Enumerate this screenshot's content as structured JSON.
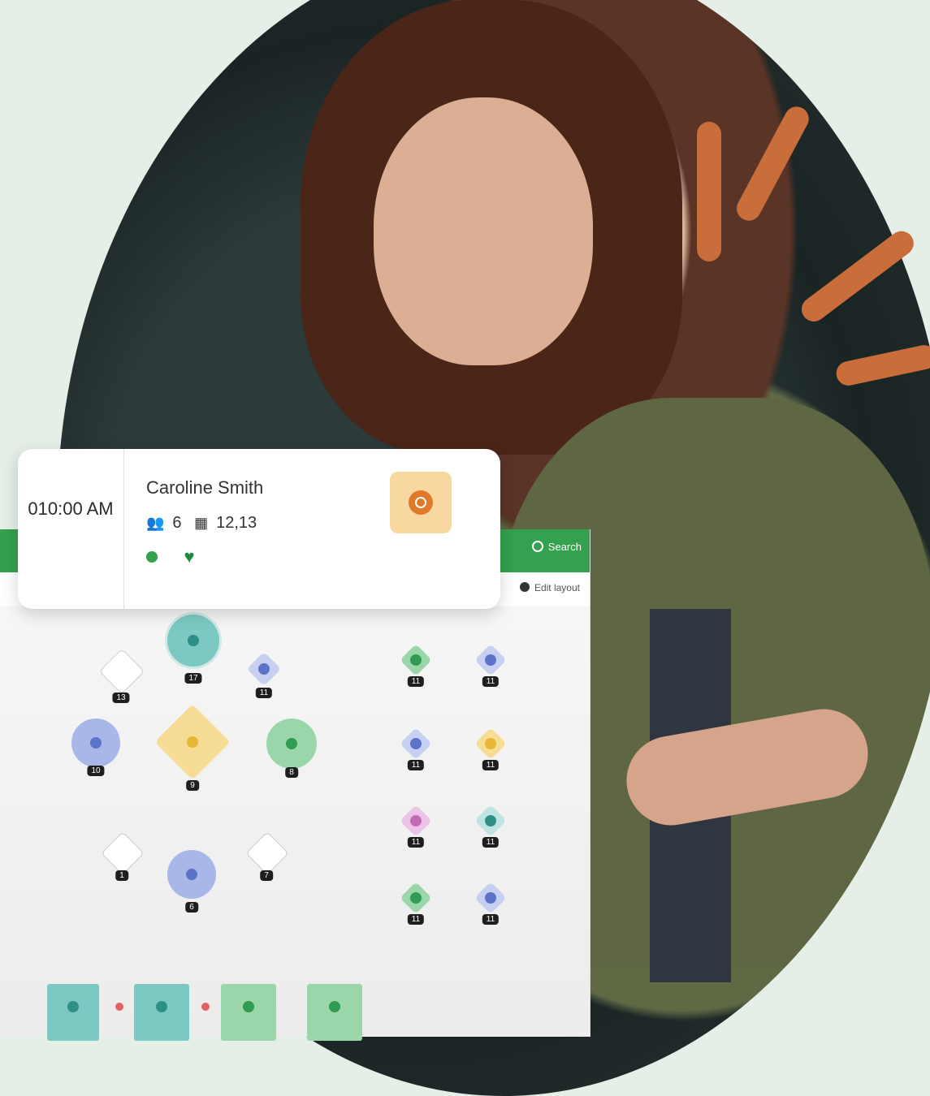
{
  "app": {
    "search_label": "Search",
    "edit_layout_label": "Edit layout"
  },
  "reservation": {
    "time": "010:00 AM",
    "guest_name": "Caroline Smith",
    "party_size": "6",
    "tables": "12,13"
  },
  "colors": {
    "brand_green": "#34a14e",
    "accent_orange": "#c96d3b",
    "teal": "#7cc9c3",
    "blue": "#8c9fd9",
    "yellow": "#f6dc95",
    "green": "#6fc08a",
    "magenta": "#c468b8"
  },
  "tables": [
    {
      "id": "t17",
      "label": "17",
      "status": "teal"
    },
    {
      "id": "t13",
      "label": "13",
      "status": "empty"
    },
    {
      "id": "t11a",
      "label": "11",
      "status": "blue"
    },
    {
      "id": "t10",
      "label": "10",
      "status": "blue"
    },
    {
      "id": "t9",
      "label": "9",
      "status": "yellow"
    },
    {
      "id": "t8",
      "label": "8",
      "status": "green"
    },
    {
      "id": "t1",
      "label": "1",
      "status": "empty"
    },
    {
      "id": "t7",
      "label": "7",
      "status": "empty"
    },
    {
      "id": "t6",
      "label": "6",
      "status": "blue"
    },
    {
      "id": "r1",
      "label": "11",
      "status": "green"
    },
    {
      "id": "r2",
      "label": "11",
      "status": "blue"
    },
    {
      "id": "r3",
      "label": "11",
      "status": "blue"
    },
    {
      "id": "r4",
      "label": "11",
      "status": "yellow"
    },
    {
      "id": "r5",
      "label": "11",
      "status": "magenta"
    },
    {
      "id": "r6",
      "label": "11",
      "status": "teal"
    },
    {
      "id": "r7",
      "label": "11",
      "status": "green"
    },
    {
      "id": "r8",
      "label": "11",
      "status": "blue"
    }
  ]
}
